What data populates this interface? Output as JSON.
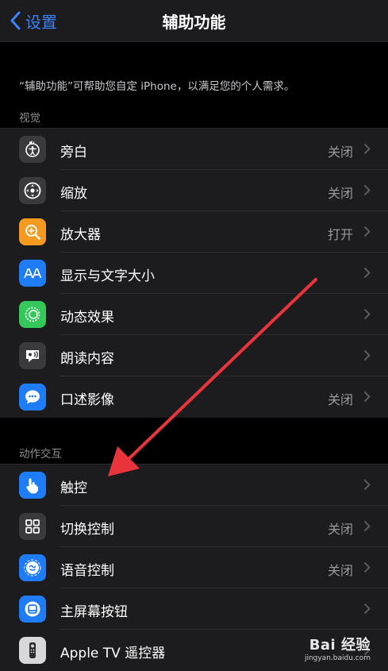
{
  "nav": {
    "back_label": "设置",
    "title": "辅助功能"
  },
  "description": "“辅助功能”可帮助您自定 iPhone，以满足您的个人需求。",
  "sections": [
    {
      "header": "视觉",
      "items": [
        {
          "label": "旁白",
          "value": "关闭",
          "icon": "voiceover-icon"
        },
        {
          "label": "缩放",
          "value": "关闭",
          "icon": "zoom-icon"
        },
        {
          "label": "放大器",
          "value": "打开",
          "icon": "magnifier-icon"
        },
        {
          "label": "显示与文字大小",
          "value": "",
          "icon": "text-size-icon"
        },
        {
          "label": "动态效果",
          "value": "",
          "icon": "motion-icon"
        },
        {
          "label": "朗读内容",
          "value": "",
          "icon": "spoken-content-icon"
        },
        {
          "label": "口述影像",
          "value": "关闭",
          "icon": "audio-description-icon"
        }
      ]
    },
    {
      "header": "动作交互",
      "items": [
        {
          "label": "触控",
          "value": "",
          "icon": "touch-icon"
        },
        {
          "label": "切换控制",
          "value": "关闭",
          "icon": "switch-control-icon"
        },
        {
          "label": "语音控制",
          "value": "关闭",
          "icon": "voice-control-icon"
        },
        {
          "label": "主屏幕按钮",
          "value": "",
          "icon": "home-button-icon"
        },
        {
          "label": "Apple TV 遥控器",
          "value": "",
          "icon": "tv-remote-icon"
        }
      ]
    }
  ],
  "watermark": {
    "main": "Bai 经验",
    "sub": "jingyan.baidu.com"
  },
  "colors": {
    "accent": "#3a82f7",
    "annotation_arrow": "#e8343a"
  }
}
